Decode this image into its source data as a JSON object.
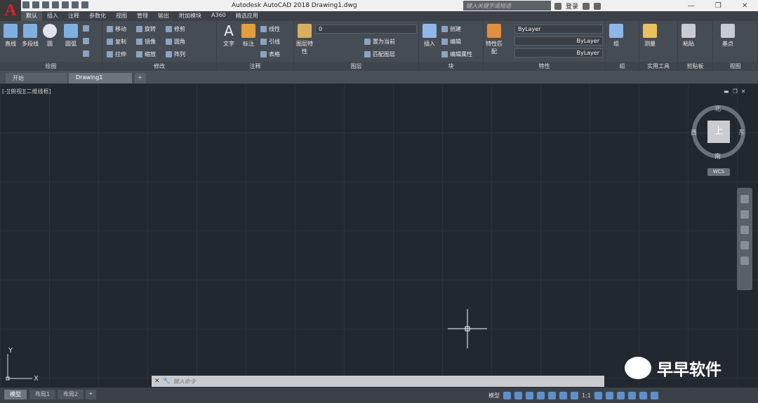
{
  "window": {
    "title": "Autodesk AutoCAD 2018    Drawing1.dwg",
    "app_logo": "A"
  },
  "search": {
    "placeholder": "键入关键字或短语"
  },
  "account": {
    "signin": "登录"
  },
  "ribbon_tabs": [
    "默认",
    "插入",
    "注释",
    "参数化",
    "视图",
    "管理",
    "输出",
    "附加模块",
    "A360",
    "精选应用"
  ],
  "panels": {
    "draw": {
      "title": "绘图",
      "line": "直线",
      "polyline": "多段线",
      "circle": "圆",
      "arc": "圆弧"
    },
    "modify": {
      "title": "修改",
      "move": "移动",
      "rotate": "旋转",
      "trim": "修剪",
      "copy": "复制",
      "mirror": "镜像",
      "fillet": "圆角",
      "stretch": "拉伸",
      "scale": "缩放",
      "array": "阵列"
    },
    "annotation": {
      "title": "注释",
      "text": "文字",
      "dimension": "标注",
      "linear": "线性",
      "leader": "引线",
      "table": "表格"
    },
    "layers": {
      "title": "图层",
      "layer_props": "图层特性",
      "current_layer": "0",
      "make_current": "置为当前",
      "match_layer": "匹配图层"
    },
    "block": {
      "title": "块",
      "insert": "插入",
      "create": "创建",
      "edit": "编辑",
      "edit_attr": "编辑属性"
    },
    "properties": {
      "title": "特性",
      "match": "特性匹配",
      "color": "ByLayer",
      "linetype": "ByLayer",
      "lineweight": "ByLayer"
    },
    "groups": {
      "title": "组",
      "group": "组"
    },
    "utilities": {
      "title": "实用工具",
      "measure": "测量"
    },
    "clipboard": {
      "title": "剪贴板",
      "paste": "粘贴"
    },
    "view": {
      "title": "视图",
      "base": "基点"
    }
  },
  "doc_tabs": [
    "开始",
    "Drawing1"
  ],
  "viewport": {
    "label": "[-][俯视][二维线框]"
  },
  "viewcube": {
    "face": "上",
    "north": "北",
    "south": "南",
    "east": "东",
    "west": "西",
    "wcs": "WCS"
  },
  "ucs": {
    "x": "X",
    "y": "Y"
  },
  "command": {
    "placeholder": "键入命令"
  },
  "watermark": {
    "text": "早早软件"
  },
  "layout_tabs": [
    "模型",
    "布局1",
    "布局2"
  ],
  "status": {
    "model": "模型",
    "scale": "1:1"
  }
}
